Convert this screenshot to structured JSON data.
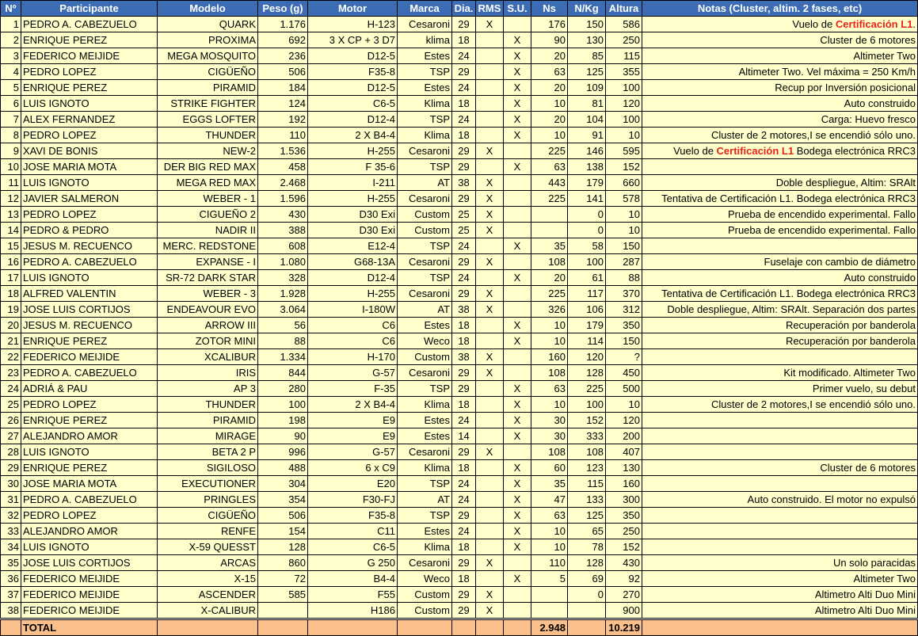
{
  "headers": [
    "Nº",
    "Participante",
    "Modelo",
    "Peso (g)",
    "Motor",
    "Marca",
    "Dia.",
    "RMS",
    "S.U.",
    "Ns",
    "N/Kg",
    "Altura",
    "Notas (Cluster, altim. 2 fases, etc)"
  ],
  "rows": [
    {
      "n": "1",
      "p": "PEDRO A. CABEZUELO",
      "m": "QUARK",
      "w": "1.176",
      "mo": "H-123",
      "ma": "Cesaroni",
      "d": "29",
      "r": "X",
      "s": "",
      "ns": "176",
      "nk": "150",
      "a": "586",
      "notes_pre": "Vuelo de ",
      "notes_red": "Certificación L1",
      "notes_post": "."
    },
    {
      "n": "2",
      "p": "ENRIQUE PEREZ",
      "m": "PROXIMA",
      "w": "692",
      "mo": "3 X CP + 3 D7",
      "ma": "klima",
      "d": "18",
      "r": "",
      "s": "X",
      "ns": "90",
      "nk": "130",
      "a": "250",
      "notes_pre": "Cluster de 6 motores",
      "notes_red": "",
      "notes_post": ""
    },
    {
      "n": "3",
      "p": "FEDERICO MEIJIDE",
      "m": "MEGA MOSQUITO",
      "w": "236",
      "mo": "D12-5",
      "ma": "Estes",
      "d": "24",
      "r": "",
      "s": "X",
      "ns": "20",
      "nk": "85",
      "a": "115",
      "notes_pre": "Altimeter Two",
      "notes_red": "",
      "notes_post": ""
    },
    {
      "n": "4",
      "p": "PEDRO LOPEZ",
      "m": "CIGÜEÑO",
      "w": "506",
      "mo": "F35-8",
      "ma": "TSP",
      "d": "29",
      "r": "",
      "s": "X",
      "ns": "63",
      "nk": "125",
      "a": "355",
      "notes_pre": "Altimeter Two.  Vel máxima = 250 Km/h",
      "notes_red": "",
      "notes_post": ""
    },
    {
      "n": "5",
      "p": "ENRIQUE PEREZ",
      "m": "PIRAMID",
      "w": "184",
      "mo": "D12-5",
      "ma": "Estes",
      "d": "24",
      "r": "",
      "s": "X",
      "ns": "20",
      "nk": "109",
      "a": "100",
      "notes_pre": "Recup por Inversión posicional",
      "notes_red": "",
      "notes_post": ""
    },
    {
      "n": "6",
      "p": "LUIS IGNOTO",
      "m": "STRIKE FIGHTER",
      "w": "124",
      "mo": "C6-5",
      "ma": "Klima",
      "d": "18",
      "r": "",
      "s": "X",
      "ns": "10",
      "nk": "81",
      "a": "120",
      "notes_pre": "Auto construido",
      "notes_red": "",
      "notes_post": ""
    },
    {
      "n": "7",
      "p": "ALEX FERNANDEZ",
      "m": "EGGS LOFTER",
      "w": "192",
      "mo": "D12-4",
      "ma": "TSP",
      "d": "24",
      "r": "",
      "s": "X",
      "ns": "20",
      "nk": "104",
      "a": "100",
      "notes_pre": "Carga: Huevo fresco",
      "notes_red": "",
      "notes_post": ""
    },
    {
      "n": "8",
      "p": "PEDRO LOPEZ",
      "m": "THUNDER",
      "w": "110",
      "mo": "2 X B4-4",
      "ma": "Klima",
      "d": "18",
      "r": "",
      "s": "X",
      "ns": "10",
      "nk": "91",
      "a": "10",
      "notes_pre": "Cluster de 2 motores,I se encendió sólo uno.",
      "notes_red": "",
      "notes_post": ""
    },
    {
      "n": "9",
      "p": "XAVI DE BONIS",
      "m": "NEW-2",
      "w": "1.536",
      "mo": "H-255",
      "ma": "Cesaroni",
      "d": "29",
      "r": "X",
      "s": "",
      "ns": "225",
      "nk": "146",
      "a": "595",
      "notes_pre": "Vuelo de ",
      "notes_red": "Certificación L1",
      "notes_post": "  Bodega electrónica RRC3"
    },
    {
      "n": "10",
      "p": "JOSE MARIA MOTA",
      "m": "DER BIG RED MAX",
      "w": "458",
      "mo": "F 35-6",
      "ma": "TSP",
      "d": "29",
      "r": "",
      "s": "X",
      "ns": "63",
      "nk": "138",
      "a": "152",
      "notes_pre": "",
      "notes_red": "",
      "notes_post": ""
    },
    {
      "n": "11",
      "p": "LUIS IGNOTO",
      "m": "MEGA RED MAX",
      "w": "2.468",
      "mo": "I-211",
      "ma": "AT",
      "d": "38",
      "r": "X",
      "s": "",
      "ns": "443",
      "nk": "179",
      "a": "660",
      "notes_pre": "Doble despliegue, Altim: SRAlt",
      "notes_red": "",
      "notes_post": ""
    },
    {
      "n": "12",
      "p": "JAVIER SALMERON",
      "m": "WEBER - 1",
      "w": "1.596",
      "mo": "H-255",
      "ma": "Cesaroni",
      "d": "29",
      "r": "X",
      "s": "",
      "ns": "225",
      "nk": "141",
      "a": "578",
      "notes_pre": "Tentativa de Certificación L1.  Bodega electrónica RRC3",
      "notes_red": "",
      "notes_post": ""
    },
    {
      "n": "13",
      "p": "PEDRO LOPEZ",
      "m": "CIGUEÑO 2",
      "w": "430",
      "mo": "D30 Exi",
      "ma": "Custom",
      "d": "25",
      "r": "X",
      "s": "",
      "ns": "",
      "nk": "0",
      "a": "10",
      "notes_pre": "Prueba de encendido experimental. Fallo",
      "notes_red": "",
      "notes_post": ""
    },
    {
      "n": "14",
      "p": "PEDRO & PEDRO",
      "m": "NADIR II",
      "w": "388",
      "mo": "D30 Exi",
      "ma": "Custom",
      "d": "25",
      "r": "X",
      "s": "",
      "ns": "",
      "nk": "0",
      "a": "10",
      "notes_pre": "Prueba de encendido experimental. Fallo",
      "notes_red": "",
      "notes_post": ""
    },
    {
      "n": "15",
      "p": "JESUS M. RECUENCO",
      "m": "MERC.  REDSTONE",
      "w": "608",
      "mo": "E12-4",
      "ma": "TSP",
      "d": "24",
      "r": "",
      "s": "X",
      "ns": "35",
      "nk": "58",
      "a": "150",
      "notes_pre": "",
      "notes_red": "",
      "notes_post": ""
    },
    {
      "n": "16",
      "p": "PEDRO A. CABEZUELO",
      "m": "EXPANSE - I",
      "w": "1.080",
      "mo": "G68-13A",
      "ma": "Cesaroni",
      "d": "29",
      "r": "X",
      "s": "",
      "ns": "108",
      "nk": "100",
      "a": "287",
      "notes_pre": "Fuselaje con cambio de diámetro",
      "notes_red": "",
      "notes_post": ""
    },
    {
      "n": "17",
      "p": "LUIS IGNOTO",
      "m": "SR-72  DARK STAR",
      "w": "328",
      "mo": "D12-4",
      "ma": "TSP",
      "d": "24",
      "r": "",
      "s": "X",
      "ns": "20",
      "nk": "61",
      "a": "88",
      "notes_pre": "Auto construido",
      "notes_red": "",
      "notes_post": ""
    },
    {
      "n": "18",
      "p": "ALFRED VALENTIN",
      "m": "WEBER - 3",
      "w": "1.928",
      "mo": "H-255",
      "ma": "Cesaroni",
      "d": "29",
      "r": "X",
      "s": "",
      "ns": "225",
      "nk": "117",
      "a": "370",
      "notes_pre": "Tentativa de Certificación L1.  Bodega electrónica RRC3",
      "notes_red": "",
      "notes_post": ""
    },
    {
      "n": "19",
      "p": "JOSE LUIS CORTIJOS",
      "m": "ENDEAVOUR EVO",
      "w": "3.064",
      "mo": "I-180W",
      "ma": "AT",
      "d": "38",
      "r": "X",
      "s": "",
      "ns": "326",
      "nk": "106",
      "a": "312",
      "notes_pre": "Doble despliegue, Altim: SRAlt. Separación dos partes",
      "notes_red": "",
      "notes_post": ""
    },
    {
      "n": "20",
      "p": "JESUS M. RECUENCO",
      "m": "ARROW III",
      "w": "56",
      "mo": "C6",
      "ma": "Estes",
      "d": "18",
      "r": "",
      "s": "X",
      "ns": "10",
      "nk": "179",
      "a": "350",
      "notes_pre": "Recuperación por banderola",
      "notes_red": "",
      "notes_post": ""
    },
    {
      "n": "21",
      "p": "ENRIQUE PEREZ",
      "m": "ZOTOR MINI",
      "w": "88",
      "mo": "C6",
      "ma": "Weco",
      "d": "18",
      "r": "",
      "s": "X",
      "ns": "10",
      "nk": "114",
      "a": "150",
      "notes_pre": "Recuperación por banderola",
      "notes_red": "",
      "notes_post": ""
    },
    {
      "n": "22",
      "p": "FEDERICO MEIJIDE",
      "m": "XCALIBUR",
      "w": "1.334",
      "mo": "H-170",
      "ma": "Custom",
      "d": "38",
      "r": "X",
      "s": "",
      "ns": "160",
      "nk": "120",
      "a": "?",
      "notes_pre": "",
      "notes_red": "",
      "notes_post": ""
    },
    {
      "n": "23",
      "p": "PEDRO A. CABEZUELO",
      "m": "IRIS",
      "w": "844",
      "mo": "G-57",
      "ma": "Cesaroni",
      "d": "29",
      "r": "X",
      "s": "",
      "ns": "108",
      "nk": "128",
      "a": "450",
      "notes_pre": "Kit modificado. Altimeter Two",
      "notes_red": "",
      "notes_post": ""
    },
    {
      "n": "24",
      "p": "ADRIÁ & PAU",
      "m": "AP 3",
      "w": "280",
      "mo": "F-35",
      "ma": "TSP",
      "d": "29",
      "r": "",
      "s": "X",
      "ns": "63",
      "nk": "225",
      "a": "500",
      "notes_pre": "Primer  vuelo, su debut",
      "notes_red": "",
      "notes_post": ""
    },
    {
      "n": "25",
      "p": "PEDRO LOPEZ",
      "m": "THUNDER",
      "w": "100",
      "mo": "2 X B4-4",
      "ma": "Klima",
      "d": "18",
      "r": "",
      "s": "X",
      "ns": "10",
      "nk": "100",
      "a": "10",
      "notes_pre": "Cluster de 2 motores,I se encendió sólo uno.",
      "notes_red": "",
      "notes_post": ""
    },
    {
      "n": "26",
      "p": "ENRIQUE PEREZ",
      "m": "PIRAMID",
      "w": "198",
      "mo": "E9",
      "ma": "Estes",
      "d": "24",
      "r": "",
      "s": "X",
      "ns": "30",
      "nk": "152",
      "a": "120",
      "notes_pre": "",
      "notes_red": "",
      "notes_post": ""
    },
    {
      "n": "27",
      "p": "ALEJANDRO AMOR",
      "m": "MIRAGE",
      "w": "90",
      "mo": "E9",
      "ma": "Estes",
      "d": "14",
      "r": "",
      "s": "X",
      "ns": "30",
      "nk": "333",
      "a": "200",
      "notes_pre": "",
      "notes_red": "",
      "notes_post": ""
    },
    {
      "n": "28",
      "p": "LUIS IGNOTO",
      "m": "BETA 2 P",
      "w": "996",
      "mo": "G-57",
      "ma": "Cesaroni",
      "d": "29",
      "r": "X",
      "s": "",
      "ns": "108",
      "nk": "108",
      "a": "407",
      "notes_pre": "",
      "notes_red": "",
      "notes_post": ""
    },
    {
      "n": "29",
      "p": "ENRIQUE PEREZ",
      "m": "SIGILOSO",
      "w": "488",
      "mo": "6 x C9",
      "ma": "Klima",
      "d": "18",
      "r": "",
      "s": "X",
      "ns": "60",
      "nk": "123",
      "a": "130",
      "notes_pre": "Cluster de 6 motores",
      "notes_red": "",
      "notes_post": ""
    },
    {
      "n": "30",
      "p": "JOSE MARIA MOTA",
      "m": "EXECUTIONER",
      "w": "304",
      "mo": "E20",
      "ma": "TSP",
      "d": "24",
      "r": "",
      "s": "X",
      "ns": "35",
      "nk": "115",
      "a": "160",
      "notes_pre": "",
      "notes_red": "",
      "notes_post": ""
    },
    {
      "n": "31",
      "p": "PEDRO A. CABEZUELO",
      "m": "PRINGLES",
      "w": "354",
      "mo": "F30-FJ",
      "ma": "AT",
      "d": "24",
      "r": "",
      "s": "X",
      "ns": "47",
      "nk": "133",
      "a": "300",
      "notes_pre": "Auto construido. El motor no expulsó",
      "notes_red": "",
      "notes_post": ""
    },
    {
      "n": "32",
      "p": "PEDRO LOPEZ",
      "m": "CIGÜEÑO",
      "w": "506",
      "mo": "F35-8",
      "ma": "TSP",
      "d": "29",
      "r": "",
      "s": "X",
      "ns": "63",
      "nk": "125",
      "a": "350",
      "notes_pre": "",
      "notes_red": "",
      "notes_post": ""
    },
    {
      "n": "33",
      "p": "ALEJANDRO AMOR",
      "m": "RENFE",
      "w": "154",
      "mo": "C11",
      "ma": "Estes",
      "d": "24",
      "r": "",
      "s": "X",
      "ns": "10",
      "nk": "65",
      "a": "250",
      "notes_pre": "",
      "notes_red": "",
      "notes_post": ""
    },
    {
      "n": "34",
      "p": "LUIS IGNOTO",
      "m": "X-59 QUESST",
      "w": "128",
      "mo": "C6-5",
      "ma": "Klima",
      "d": "18",
      "r": "",
      "s": "X",
      "ns": "10",
      "nk": "78",
      "a": "152",
      "notes_pre": "",
      "notes_red": "",
      "notes_post": ""
    },
    {
      "n": "35",
      "p": "JOSE LUIS CORTIJOS",
      "m": "ARCAS",
      "w": "860",
      "mo": "G 250",
      "ma": "Cesaroni",
      "d": "29",
      "r": "X",
      "s": "",
      "ns": "110",
      "nk": "128",
      "a": "430",
      "notes_pre": "Un solo paracidas",
      "notes_red": "",
      "notes_post": ""
    },
    {
      "n": "36",
      "p": "FEDERICO MEIJIDE",
      "m": "X-15",
      "w": "72",
      "mo": "B4-4",
      "ma": "Weco",
      "d": "18",
      "r": "",
      "s": "X",
      "ns": "5",
      "nk": "69",
      "a": "92",
      "notes_pre": "Altimeter Two",
      "notes_red": "",
      "notes_post": ""
    },
    {
      "n": "37",
      "p": "FEDERICO MEIJIDE",
      "m": "ASCENDER",
      "w": "585",
      "mo": "F55",
      "ma": "Custom",
      "d": "29",
      "r": "X",
      "s": "",
      "ns": "",
      "nk": "0",
      "a": "270",
      "notes_pre": "Altimetro Alti Duo Mini",
      "notes_red": "",
      "notes_post": ""
    },
    {
      "n": "38",
      "p": "FEDERICO MEIJIDE",
      "m": "X-CALIBUR",
      "w": "",
      "mo": "H186",
      "ma": "Custom",
      "d": "29",
      "r": "X",
      "s": "",
      "ns": "",
      "nk": "",
      "a": "900",
      "notes_pre": "Altimetro Alti Duo Mini",
      "notes_red": "",
      "notes_post": ""
    }
  ],
  "total": {
    "label": "TOTAL",
    "ns": "2.948",
    "altura": "10.219"
  },
  "colors": {
    "header_bg": "#3c6db4",
    "cell_bg": "#ffffcc",
    "total_bg": "#fbbf8c",
    "highlight": "#e8231a"
  }
}
